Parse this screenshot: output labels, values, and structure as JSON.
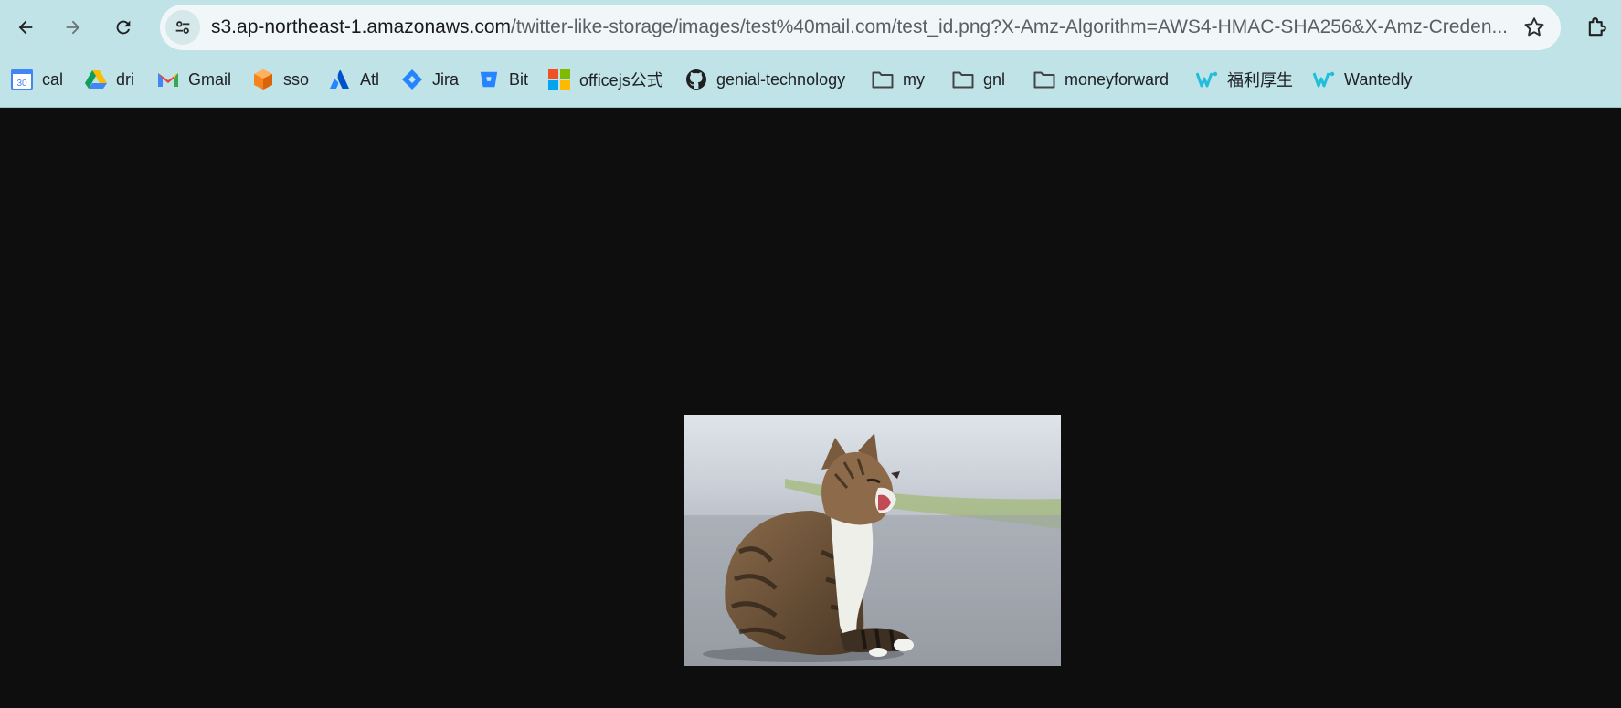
{
  "nav": {
    "back_icon": "arrow-left-icon",
    "forward_icon": "arrow-right-icon",
    "reload_icon": "reload-icon"
  },
  "omnibox": {
    "site_info_icon": "tune-icon",
    "url_host": "s3.ap-northeast-1.amazonaws.com",
    "url_path": "/twitter-like-storage/images/test%40mail.com/test_id.png?X-Amz-Algorithm=AWS4-HMAC-SHA256&X-Amz-Creden...",
    "star_icon": "star-outline-icon"
  },
  "extensions_icon": "puzzle-icon",
  "bookmarks": [
    {
      "label": "cal",
      "icon": "google-calendar-icon",
      "icon_text": "30"
    },
    {
      "label": "dri",
      "icon": "google-drive-icon"
    },
    {
      "label": "Gmail",
      "icon": "gmail-icon"
    },
    {
      "label": "sso",
      "icon": "orange-cube-icon"
    },
    {
      "label": "Atl",
      "icon": "atlassian-icon"
    },
    {
      "label": "Jira",
      "icon": "jira-icon"
    },
    {
      "label": "Bit",
      "icon": "bitbucket-icon"
    },
    {
      "label": "officejs公式",
      "icon": "microsoft-icon"
    },
    {
      "label": "genial-technology",
      "icon": "github-icon"
    },
    {
      "label": "my",
      "icon": "folder-icon"
    },
    {
      "label": "gnl",
      "icon": "folder-icon"
    },
    {
      "label": "moneyforward",
      "icon": "folder-icon"
    },
    {
      "label": "福利厚生",
      "icon": "wantedly-icon"
    },
    {
      "label": "Wantedly",
      "icon": "wantedly-icon"
    }
  ],
  "colors": {
    "toolbar_bg": "#bfe3e6",
    "page_bg": "#0e0e0e",
    "omnibox_bg": "#f1f7f8"
  },
  "image": {
    "subject": "yawning tabby cat sitting on pavement"
  }
}
